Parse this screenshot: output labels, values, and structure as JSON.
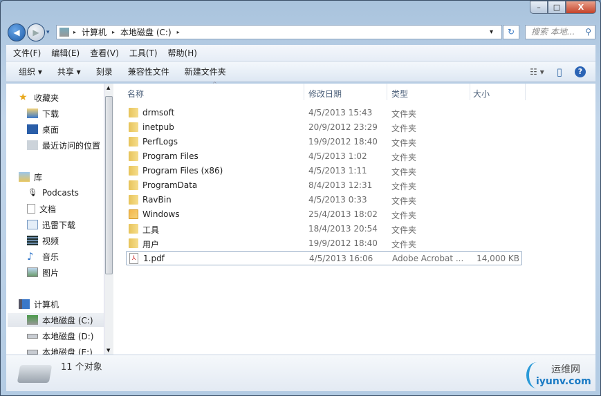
{
  "window": {
    "minimize": "–",
    "maximize": "□",
    "close": "X"
  },
  "address": {
    "segments": [
      "计算机",
      "本地磁盘 (C:)"
    ],
    "separator": "▸",
    "dropdown": "▾",
    "refresh_icon": "↻"
  },
  "search": {
    "placeholder": "搜索 本地...",
    "icon": "⚲"
  },
  "menu": [
    "文件(F)",
    "编辑(E)",
    "查看(V)",
    "工具(T)",
    "帮助(H)"
  ],
  "toolbar": {
    "items": [
      "组织 ▾",
      "共享 ▾",
      "刻录",
      "兼容性文件",
      "新建文件夹"
    ],
    "views": "☷ ▾",
    "preview": "▯",
    "help": "?"
  },
  "nav": {
    "favorites": {
      "label": "收藏夹",
      "items": [
        "下载",
        "桌面",
        "最近访问的位置"
      ]
    },
    "libraries": {
      "label": "库",
      "items": [
        "Podcasts",
        "文档",
        "迅雷下载",
        "视频",
        "音乐",
        "图片"
      ]
    },
    "computer": {
      "label": "计算机",
      "items": [
        "本地磁盘 (C:)",
        "本地磁盘 (D:)",
        "本地磁盘 (E:)"
      ]
    }
  },
  "columns": [
    "名称",
    "修改日期",
    "类型",
    "大小"
  ],
  "files": [
    {
      "name": "drmsoft",
      "date": "4/5/2013 15:43",
      "type": "文件夹",
      "size": ""
    },
    {
      "name": "inetpub",
      "date": "20/9/2012 23:29",
      "type": "文件夹",
      "size": ""
    },
    {
      "name": "PerfLogs",
      "date": "19/9/2012 18:40",
      "type": "文件夹",
      "size": ""
    },
    {
      "name": "Program Files",
      "date": "4/5/2013 1:02",
      "type": "文件夹",
      "size": ""
    },
    {
      "name": "Program Files (x86)",
      "date": "4/5/2013 1:11",
      "type": "文件夹",
      "size": ""
    },
    {
      "name": "ProgramData",
      "date": "8/4/2013 12:31",
      "type": "文件夹",
      "size": ""
    },
    {
      "name": "RavBin",
      "date": "4/5/2013 0:33",
      "type": "文件夹",
      "size": ""
    },
    {
      "name": "Windows",
      "date": "25/4/2013 18:02",
      "type": "文件夹",
      "size": ""
    },
    {
      "name": "工具",
      "date": "18/4/2013 20:54",
      "type": "文件夹",
      "size": ""
    },
    {
      "name": "用户",
      "date": "19/9/2012 18:40",
      "type": "文件夹",
      "size": ""
    },
    {
      "name": "1.pdf",
      "date": "4/5/2013 16:06",
      "type": "Adobe Acrobat ...",
      "size": "14,000 KB"
    }
  ],
  "status": {
    "count": "11 个对象"
  },
  "watermark": {
    "cn": "运维网",
    "url": "iyunv.com"
  }
}
